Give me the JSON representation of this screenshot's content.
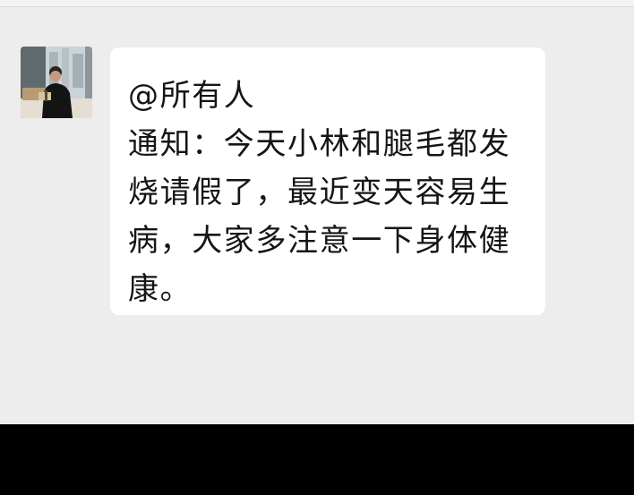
{
  "conversation": {
    "message": {
      "sender_avatar": "person-reading-by-window-photo",
      "lines": [
        "@所有人",
        "通知：今天小林和腿毛都发",
        "烧请假了，最近变天容易生",
        "病，大家多注意一下身体健",
        "康。"
      ]
    }
  },
  "colors": {
    "chat_background": "#ededed",
    "bubble_background": "#ffffff",
    "text": "#151515",
    "bottom_bar": "#000000"
  }
}
